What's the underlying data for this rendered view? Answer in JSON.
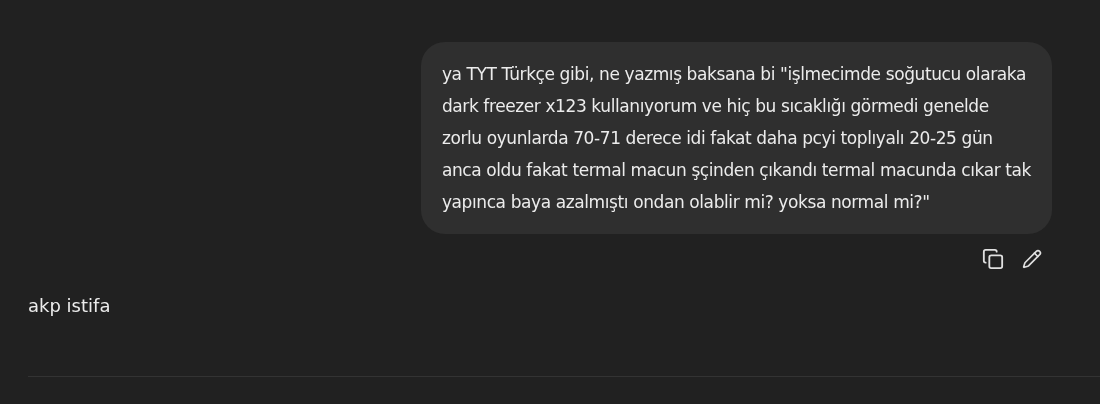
{
  "messages": [
    {
      "kind": "user",
      "lines": [
        "ya TYT Türkçe gibi, ne yazmış baksana bi \"işlmecimde soğutucu olaraka",
        "dark freezer x123 kullanıyorum ve hiç bu sıcaklığı görmedi genelde",
        "zorlu oyunlarda 70-71 derece idi fakat daha pcyi toplıyalı 20-25 gün",
        "anca oldu fakat termal macun şçinden çıkandı termal macunda cıkar tak",
        "yapınca baya azalmıştı ondan olablir mi? yoksa normal mi?\""
      ]
    },
    {
      "kind": "assistant",
      "lines": [
        "akp istifa"
      ]
    }
  ]
}
